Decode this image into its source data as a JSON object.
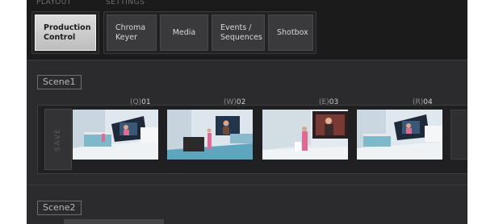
{
  "tab_groups": {
    "playout": {
      "label": "PLAYOUT",
      "tabs": [
        {
          "label": "Production\nControl",
          "active": true
        }
      ]
    },
    "settings": {
      "label": "SETTINGS",
      "tabs": [
        {
          "label": "Chroma\nKeyer",
          "active": false
        },
        {
          "label": "Media",
          "active": false
        },
        {
          "label": "Events /\nSequences",
          "active": false
        },
        {
          "label": "Shotbox",
          "active": false
        }
      ]
    }
  },
  "scenes": [
    {
      "name": "Scene1",
      "save_label": "SAVE",
      "shots": [
        {
          "key": "(Q)",
          "number": "01"
        },
        {
          "key": "(W)",
          "number": "02"
        },
        {
          "key": "(E)",
          "number": "03"
        },
        {
          "key": "(R)",
          "number": "04"
        }
      ]
    },
    {
      "name": "Scene2"
    }
  ],
  "colors": {
    "background": "#2b2b2d",
    "active_tab": "#cfcfcf",
    "accent_pink": "#e06a93"
  }
}
